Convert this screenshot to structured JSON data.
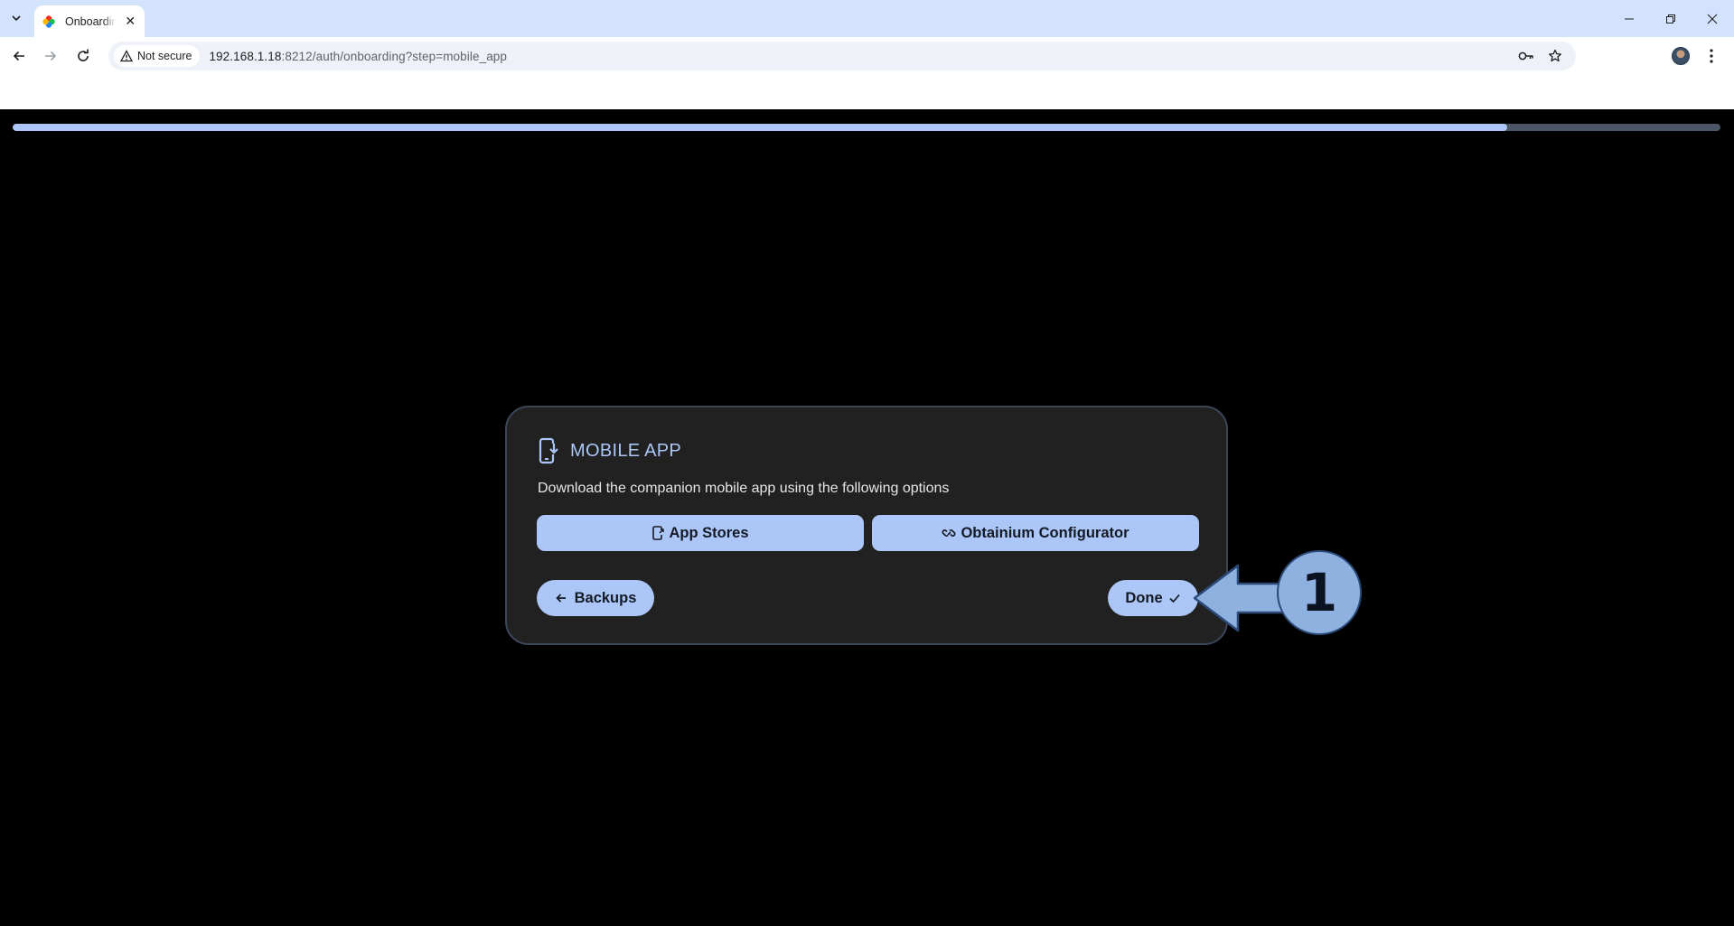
{
  "browser": {
    "tab": {
      "title": "Onboarding"
    },
    "address": {
      "security_label": "Not secure",
      "url_host": "192.168.1.18",
      "url_rest": ":8212/auth/onboarding?step=mobile_app"
    }
  },
  "page": {
    "progress_fraction": 0.875,
    "card": {
      "title": "MOBILE APP",
      "description": "Download the companion mobile app using the following options",
      "app_stores_label": "App Stores",
      "obtainium_label": "Obtainium Configurator",
      "back_label": "Backups",
      "done_label": "Done"
    }
  },
  "annotation": {
    "step_number": "1"
  },
  "colors": {
    "accent": "#acc7f7",
    "card_bg": "#212121",
    "page_bg": "#000000",
    "chrome": "#d3e3fd"
  }
}
